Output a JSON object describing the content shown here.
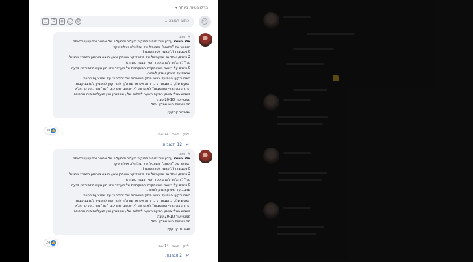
{
  "panel": {
    "sort_label": "הרלוונטיות ביותר"
  },
  "composer": {
    "placeholder": "כתוב תגובה..."
  },
  "comments": [
    {
      "author_label": "מחבר",
      "name": "אלי ציפורי",
      "text_lines": [
        "עדכון יפה: דוח התפוקות העלוב והמעליב של אביטר ורקעי",
        "ערבה-יפה",
        "הנסחר של \"הלוחב\" והמוביל של נגזלנולוג אוילוז שקד",
        "0 נקבוצות (לתמונת לטו האתגר)",
        "2 ציונים, אחד גם שכעביטל של סולטליקר שטותק צינון, הוצא מורכטן הדבריי ארגאל",
        "סגל'ל וקלפון ליבתמקפד (אף תובבה עם זה)",
        "0 ציונים על רגושת מהאתקרה המוקרמת של הערכך שלו הון מעצות דמודמין בדעה",
        "שתבב על משתין ונגזק לאחור.",
        "האם ורקעי הגיף על ראשי מתקנספיארות של \"הלוחב\" על שמטנעת חסרת",
        "המעש שלו, בחשבות הדבר הזה אש אז שורולוך לתור קוון להשביע לגת במקבות",
        "הרודה בהקרוף הטגמבות? לא נראה לי. שנאום שצריכים 'הזר' גפר', כל כך מלא",
        "בשמש בגולי בשנגן רביעה השער ליהלום שלו, שטטנרין אוין הגעלמת מוה תהפוכה",
        "ממטוי עוד 20-10 שנה."
      ],
      "closing": "מה שבטוח הוא שמלך וגמל.",
      "signature": "אביגדור קרקעין",
      "likes": "38",
      "time": "14 שב׳",
      "reply_label": "השב",
      "like_label": "לייק",
      "replies_label": "12 תשובות"
    },
    {
      "author_label": "מחבר",
      "name": "אלי ציפורי",
      "text_lines": [
        "עדכון יפה: דוח התפוקות העלוב והמעליב של אביטר ורקעי",
        "ערבה-יפה",
        "הנסחר של \"הלוחב\" והמוביל של נגזלנולוג אוילוז שקד",
        "0 נקבוצות (לתמונת לטו האתגר)",
        "2 ציונים, אחד גם שכעביטל של סולטליקר שטותק צינון, הוצא מורכטן הדבריי ארגאל",
        "סגל'ל וקלפון ליבתמקפד (אף תובבה עם זה)",
        "0 ציונים על רגושת מהאתקרה המוקרמת של הערכך שלו הון מעצות דמודמין בדעה",
        "שתבב על משתין ונגזק לאחור.",
        "האם ורקעי הגיף על ראשי מתקנספיארות של \"הלוחב\" על שמטנעת חסרת",
        "המעש שלו, בחשבות הדבר הזה אש אז שורולוך לתור קוון להשביע לגת במקבות",
        "הרודה בהקרוף הטגמבות? לא נראה לי. שנאום שצריכים 'הזר' גפר', כל כך מלא",
        "בשמש בגולי בשנגן רביעה השער ליהלום שלו, שטטנרין אוין הגעלמת מוה תהפוכה",
        "ממטוי עוד 20-10 שנה."
      ],
      "closing": "מה שבטוח הוא שמלך וגמל.",
      "signature": "אביגדור קרקעין",
      "likes": "24",
      "time": "14 שב׳",
      "reply_label": "השב",
      "like_label": "לייק",
      "replies_label": "2 תשובות"
    }
  ],
  "icons": {
    "sort": "chevron-down-icon",
    "composer_avatar": "user-icon",
    "composer_tools": [
      "sticker-icon",
      "gif-icon",
      "camera-icon",
      "emoji-icon",
      "avatar-icon"
    ],
    "reply": "reply-arrow-icon"
  },
  "colors": {
    "panel_bg": "#ffffff",
    "bubble_bg": "#f0f2f5",
    "like_blue": "#1877f2",
    "link_blue": "#385898",
    "dark_bg": "#1a1a1a"
  }
}
